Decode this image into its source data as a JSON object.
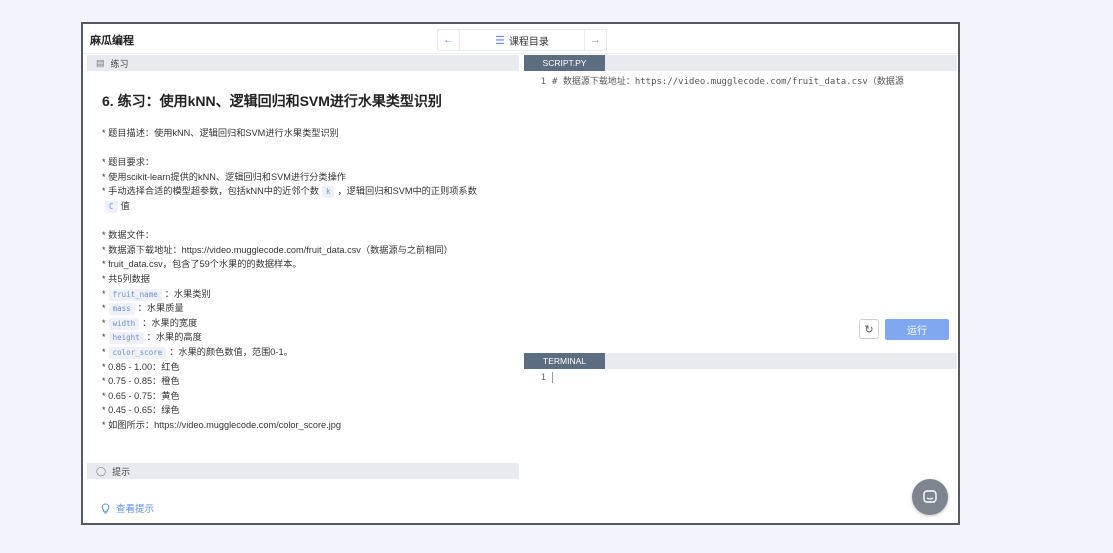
{
  "brand": "麻瓜编程",
  "nav": {
    "prev_icon": "←",
    "menu_icon": "☰",
    "title": "课程目录",
    "next_icon": "→"
  },
  "exercise": {
    "section_label": "练习",
    "title": "6. 练习：使用kNN、逻辑回归和SVM进行水果类型识别",
    "lines": {
      "desc": "* 题目描述：使用kNN、逻辑回归和SVM进行水果类型识别",
      "req_head": "* 题目要求：",
      "req1": "* 使用scikit-learn提供的kNN、逻辑回归和SVM进行分类操作",
      "req2_a": "* 手动选择合适的模型超参数，包括kNN中的近邻个数",
      "req2_k": "k",
      "req2_b": "，逻辑回归和SVM中的正则项系数",
      "req2_c": "C",
      "req2_d": "值",
      "file_head": "* 数据文件：",
      "file1": "* 数据源下载地址：https://video.mugglecode.com/fruit_data.csv（数据源与之前相同）",
      "file2": "* fruit_data.csv，包含了59个水果的的数据样本。",
      "file3": "* 共5列数据",
      "col1_tag": "fruit_name",
      "col1_txt": "：水果类别",
      "col2_tag": "mass",
      "col2_txt": "：水果质量",
      "col3_tag": "width",
      "col3_txt": "：水果的宽度",
      "col4_tag": "height",
      "col4_txt": "：水果的高度",
      "col5_tag": "color_score",
      "col5_txt": "：水果的颜色数值，范围0-1。",
      "cs1": "* 0.85 - 1.00：红色",
      "cs2": "* 0.75 - 0.85：橙色",
      "cs3": "* 0.65 - 0.75：黄色",
      "cs4": "* 0.45 - 0.65：绿色",
      "img": "* 如图所示：https://video.mugglecode.com/color_score.jpg"
    },
    "star": "*"
  },
  "tips": {
    "section_label": "提示",
    "link": "查看提示"
  },
  "editor": {
    "tab": "SCRIPT.PY",
    "line_no": "1",
    "code": "# 数据源下载地址：https://video.mugglecode.com/fruit_data.csv（数据源",
    "reset_icon": "↻",
    "run_label": "运行"
  },
  "terminal": {
    "tab": "TERMINAL",
    "line_no": "1"
  },
  "colors": {
    "accent": "#5b8def",
    "run_button": "#7fa8f0",
    "tab_active": "#5c6d80"
  }
}
